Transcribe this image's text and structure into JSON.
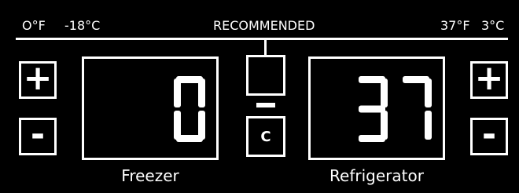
{
  "scale": {
    "freezer_f": "O°F",
    "freezer_c": "-18°C",
    "recommended": "RECOMMENDED",
    "fridge_f": "37°F",
    "fridge_c": "3°C"
  },
  "freezer": {
    "plus_label": "+",
    "minus_label": "-",
    "value": "0",
    "caption": "Freezer"
  },
  "refrigerator": {
    "plus_label": "+",
    "minus_label": "-",
    "value": "37",
    "caption": "Refrigerator"
  },
  "center": {
    "unit_button_label": "C"
  },
  "colors": {
    "background": "#000000",
    "foreground": "#ffffff"
  }
}
